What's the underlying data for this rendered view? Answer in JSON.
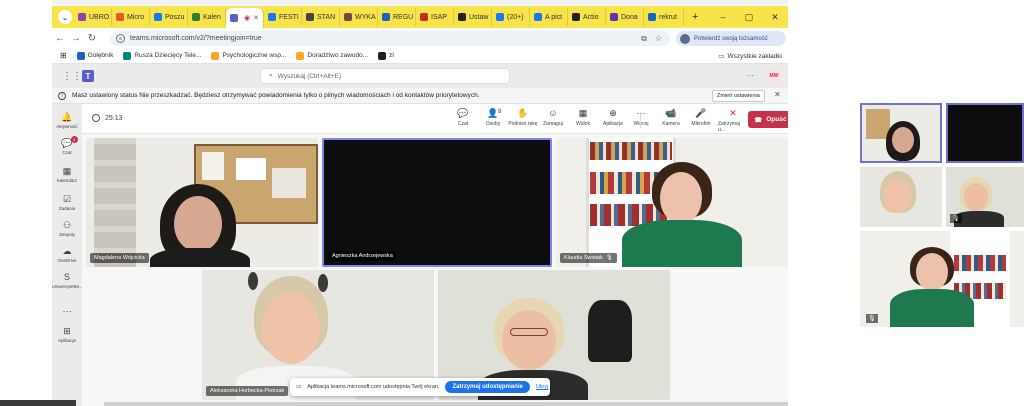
{
  "browser": {
    "tabs": [
      {
        "label": "UBRO",
        "color": "#8e44ad"
      },
      {
        "label": "Micro",
        "color": "#e8542f"
      },
      {
        "label": "Poszu",
        "color": "#1877f2"
      },
      {
        "label": "Kalen",
        "color": "#2e7d32"
      },
      {
        "label": "",
        "color": "#5b5fc7",
        "active": true
      },
      {
        "label": "FESTI",
        "color": "#1877f2"
      },
      {
        "label": "STAN",
        "color": "#444444"
      },
      {
        "label": "WYKA",
        "color": "#6d4c41"
      },
      {
        "label": "REGU",
        "color": "#1565c0"
      },
      {
        "label": "ISAP",
        "color": "#c62828"
      },
      {
        "label": "Ustaw",
        "color": "#222222"
      },
      {
        "label": "(20+)",
        "color": "#1877f2"
      },
      {
        "label": "A pict",
        "color": "#1877f2"
      },
      {
        "label": "Actio",
        "color": "#222222"
      },
      {
        "label": "Dona",
        "color": "#5e35b1"
      },
      {
        "label": "rekrut",
        "color": "#1565c0"
      }
    ],
    "url": "teams.microsoft.com/v2/?meetingjoin=true",
    "verify_label": "Potwierdź swoją tożsamość",
    "bookmarks": [
      {
        "label": "Gołębnik",
        "color": "#1565c0"
      },
      {
        "label": "Rusza Dziecięcy Tele...",
        "color": "#00897b"
      },
      {
        "label": "Psychologiczne wsp...",
        "color": "#f9a825"
      },
      {
        "label": "Doradztwo zawodo...",
        "color": "#f9a825"
      },
      {
        "label": "zl",
        "color": "#222222"
      }
    ],
    "all_bookmarks": "Wszystkie zakładki"
  },
  "teams": {
    "search_placeholder": "Wyszukaj (Ctrl+Alt+E)",
    "avatar_initials": "MW",
    "notice_text": "Masz ustawiony status Nie przeszkadzać. Będziesz otrzymywać powiadomienia tylko o pilnych wiadomościach i od kontaktów priorytetowych.",
    "notice_button": "Zmień ustawienia",
    "rail": [
      {
        "label": "Aktywność",
        "icon": "bell-icon"
      },
      {
        "label": "Czat",
        "icon": "chat-icon",
        "badge": "1"
      },
      {
        "label": "Kalendarz",
        "icon": "calendar-icon"
      },
      {
        "label": "Zadania",
        "icon": "tasks-icon"
      },
      {
        "label": "Zespoły",
        "icon": "teams-icon"
      },
      {
        "label": "OneDrive",
        "icon": "cloud-icon"
      },
      {
        "label": "UniwersytetM...",
        "icon": "sharepoint-icon"
      },
      {
        "label": "",
        "icon": "more-icon"
      },
      {
        "label": "Aplikacje",
        "icon": "apps-icon"
      }
    ]
  },
  "meeting": {
    "timer": "25:13",
    "toolbar": [
      {
        "label": "Czat",
        "glyph": "💬"
      },
      {
        "label": "Osoby",
        "glyph": "👤"
      },
      {
        "label": "Podnieś rękę",
        "glyph": "✋"
      },
      {
        "label": "Zareaguj",
        "glyph": "☺"
      },
      {
        "label": "Widok",
        "glyph": "▦"
      },
      {
        "label": "Aplikacje",
        "glyph": "⊕"
      },
      {
        "label": "Więcej",
        "glyph": "···"
      },
      {
        "label": "Kamera",
        "glyph": "📹"
      },
      {
        "label": "Mikrofon",
        "glyph": "🎤"
      },
      {
        "label": "Zatrzymaj u...",
        "glyph": "✕"
      }
    ],
    "people_count": "8",
    "leave_label": "Opuść",
    "participants": [
      "Magdalena Wójcicka",
      "Agnieszka Andrzejewska",
      "Klaudia Świstak",
      "Aleksandra Horbecka-Pietrzak",
      ""
    ]
  },
  "share_toast": {
    "text": "Aplikacja teams.microsoft.com udostępnia Twój ekran.",
    "stop_label": "Zatrzymaj udostępnianie",
    "hide_label": "Ukryj"
  },
  "colors": {
    "tabstrip": "#f7e34a",
    "teams_brand": "#5b5fc7",
    "leave": "#c4314b"
  }
}
